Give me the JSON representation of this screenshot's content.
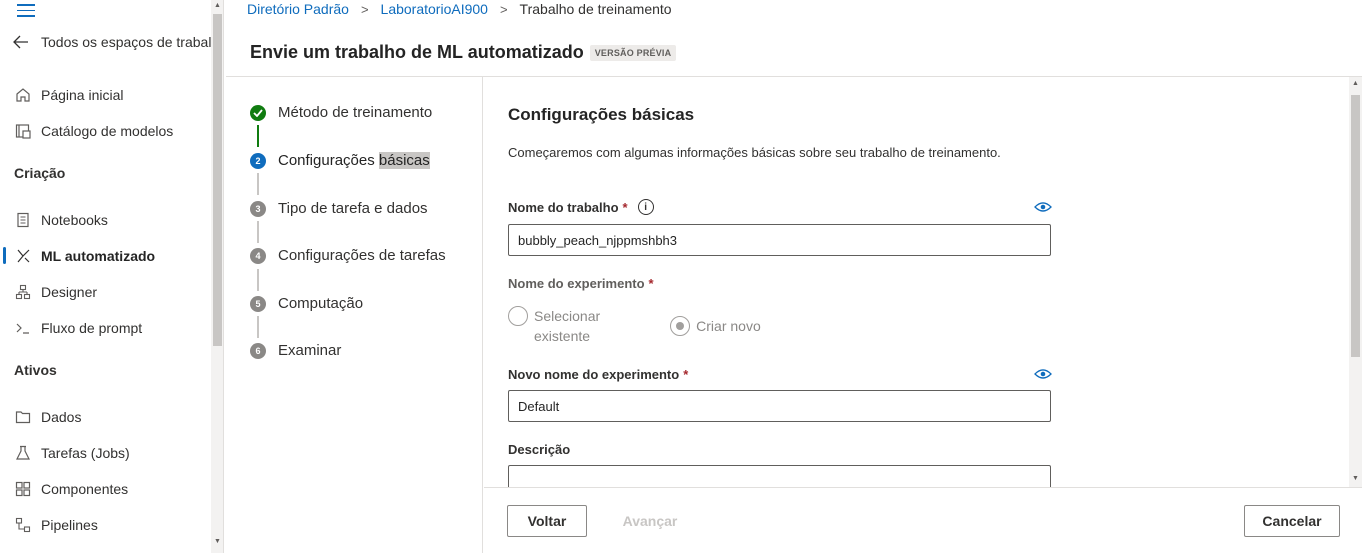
{
  "nav": {
    "back_label": "Todos os espaços de trabal",
    "items_top": [
      {
        "label": "Página inicial",
        "icon": "home-icon"
      },
      {
        "label": "Catálogo de modelos",
        "icon": "catalog-icon"
      }
    ],
    "section_criacao": "Criação",
    "items_criacao": [
      {
        "label": "Notebooks",
        "icon": "notebook-icon"
      },
      {
        "label": "ML automatizado",
        "icon": "automl-icon"
      },
      {
        "label": "Designer",
        "icon": "designer-icon"
      },
      {
        "label": "Fluxo de prompt",
        "icon": "prompt-flow-icon"
      }
    ],
    "section_ativos": "Ativos",
    "items_ativos": [
      {
        "label": "Dados",
        "icon": "data-icon"
      },
      {
        "label": "Tarefas (Jobs)",
        "icon": "flask-icon"
      },
      {
        "label": "Componentes",
        "icon": "components-icon"
      },
      {
        "label": "Pipelines",
        "icon": "pipelines-icon"
      }
    ],
    "active_item": "ML automatizado"
  },
  "breadcrumb": {
    "items": [
      "Diretório Padrão",
      "LaboratorioAI900"
    ],
    "current": "Trabalho de treinamento"
  },
  "header": {
    "title": "Envie um trabalho de ML automatizado",
    "badge": "VERSÃO PRÉVIA"
  },
  "steps": [
    {
      "num": "",
      "label": "Método de treinamento",
      "state": "done"
    },
    {
      "num": "2",
      "label_a": "Configurações ",
      "label_b": "básicas",
      "state": "current"
    },
    {
      "num": "3",
      "label": "Tipo de tarefa e dados",
      "state": "todo"
    },
    {
      "num": "4",
      "label": "Configurações de tarefas",
      "state": "todo"
    },
    {
      "num": "5",
      "label": "Computação",
      "state": "todo"
    },
    {
      "num": "6",
      "label": "Examinar",
      "state": "todo"
    }
  ],
  "form": {
    "title": "Configurações básicas",
    "description": "Começaremos com algumas informações básicas sobre seu trabalho de treinamento.",
    "job_name_label": "Nome do trabalho",
    "job_name_value": "bubbly_peach_njppmshbh3",
    "experiment_label": "Nome do experimento",
    "radio_existing_line1": "Selecionar",
    "radio_existing_line2": "existente",
    "radio_new": "Criar novo",
    "new_experiment_label": "Novo nome do experimento",
    "new_experiment_value": "Default",
    "description_label": "Descrição",
    "required_mark": "*",
    "info_glyph": "i"
  },
  "footer": {
    "back": "Voltar",
    "next": "Avançar",
    "cancel": "Cancelar"
  },
  "colors": {
    "accent": "#0f6cbd",
    "done_green": "#107c10",
    "required_red": "#a4262c"
  }
}
